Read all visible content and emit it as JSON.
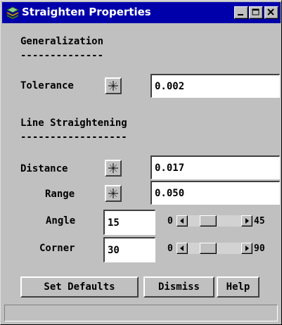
{
  "window": {
    "title": "Straighten Properties",
    "app_icon": "stacked-layers-icon",
    "controls": [
      "minimize-icon",
      "maximize-icon",
      "close-icon"
    ]
  },
  "generalization": {
    "title": "Generalization",
    "rule": "--------------",
    "tolerance": {
      "label": "Tolerance",
      "value": "0.002",
      "pick_icon": "crosshair-icon"
    }
  },
  "line_straightening": {
    "title": "Line Straightening",
    "rule": "------------------",
    "distance": {
      "label": "Distance",
      "value": "0.017",
      "pick_icon": "crosshair-icon"
    },
    "range": {
      "label": "Range",
      "value": "0.050",
      "pick_icon": "crosshair-icon"
    },
    "angle": {
      "label": "Angle",
      "value": "15",
      "min": "0",
      "max": "45",
      "level": 0.333
    },
    "corner": {
      "label": "Corner",
      "value": "30",
      "min": "0",
      "max": "90",
      "level": 0.333
    }
  },
  "buttons": {
    "set_defaults": "Set Defaults",
    "dismiss": "Dismiss",
    "help": "Help"
  },
  "status": {
    "text": ""
  },
  "colors": {
    "titlebar": "#0000aa",
    "face": "#c0c0c0",
    "field": "#ffffff"
  }
}
